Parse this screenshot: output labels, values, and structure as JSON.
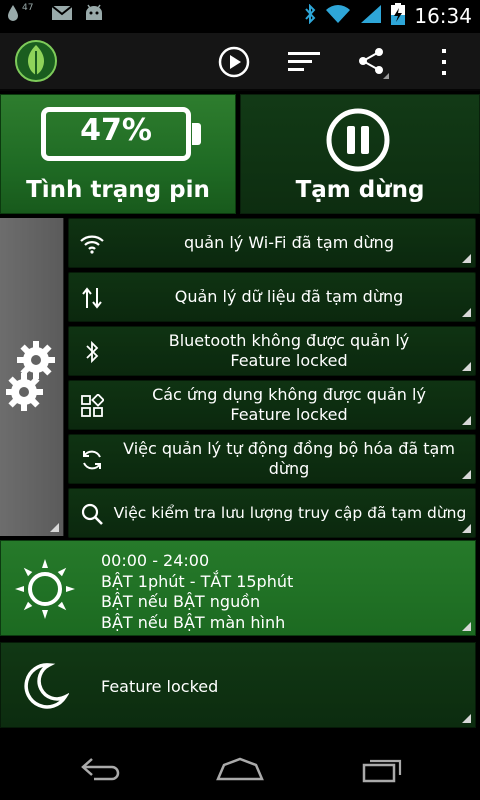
{
  "status_bar": {
    "clock": "16:34",
    "notification_count": "47",
    "icons": [
      "battery-drop-icon",
      "gmail-icon",
      "android-icon",
      "bluetooth-icon",
      "wifi-icon",
      "signal-icon",
      "battery-charging-icon"
    ]
  },
  "action_bar": {
    "icons": [
      "app-logo-leaf-icon",
      "play-icon",
      "sort-icon",
      "share-icon",
      "overflow-menu-icon"
    ]
  },
  "battery_tile": {
    "percent": "47%",
    "label": "Tình trạng pin",
    "level": 0.47
  },
  "pause_tile": {
    "label": "Tạm dừng",
    "icon": "pause-circle-icon"
  },
  "settings": {
    "icon": "gears-icon",
    "rows": [
      {
        "icon": "wifi-icon",
        "line1": "quản lý Wi-Fi đã tạm dừng",
        "line2": ""
      },
      {
        "icon": "data-arrows-icon",
        "line1": "Quản lý dữ liệu đã tạm dừng",
        "line2": ""
      },
      {
        "icon": "bluetooth-icon",
        "line1": "Bluetooth không được quản lý",
        "line2": "Feature locked"
      },
      {
        "icon": "apps-icon",
        "line1": "Các ứng dụng không được quản lý",
        "line2": "Feature locked"
      },
      {
        "icon": "sync-icon",
        "line1": "Việc quản lý tự động đồng bộ hóa đã tạm",
        "line2": "dừng"
      },
      {
        "icon": "search-icon",
        "line1": "Việc kiểm tra lưu lượng truy cập đã tạm dừng",
        "line2": ""
      }
    ]
  },
  "schedule": {
    "icon": "sun-icon",
    "lines": [
      "00:00 - 24:00",
      "BẬT 1phút - TẮT 15phút",
      "BẬT nếu BẬT nguồn",
      "BẬT nếu BẬT màn hình"
    ]
  },
  "night": {
    "icon": "moon-icon",
    "text": "Feature locked"
  },
  "nav_bar": {
    "icons": [
      "back-icon",
      "home-icon",
      "recent-apps-icon"
    ]
  },
  "colors": {
    "accent_green": "#267a2a",
    "dark_green": "#0f3312",
    "settings_gray": "#636363",
    "statusbar_blue": "#2ea6d8"
  }
}
